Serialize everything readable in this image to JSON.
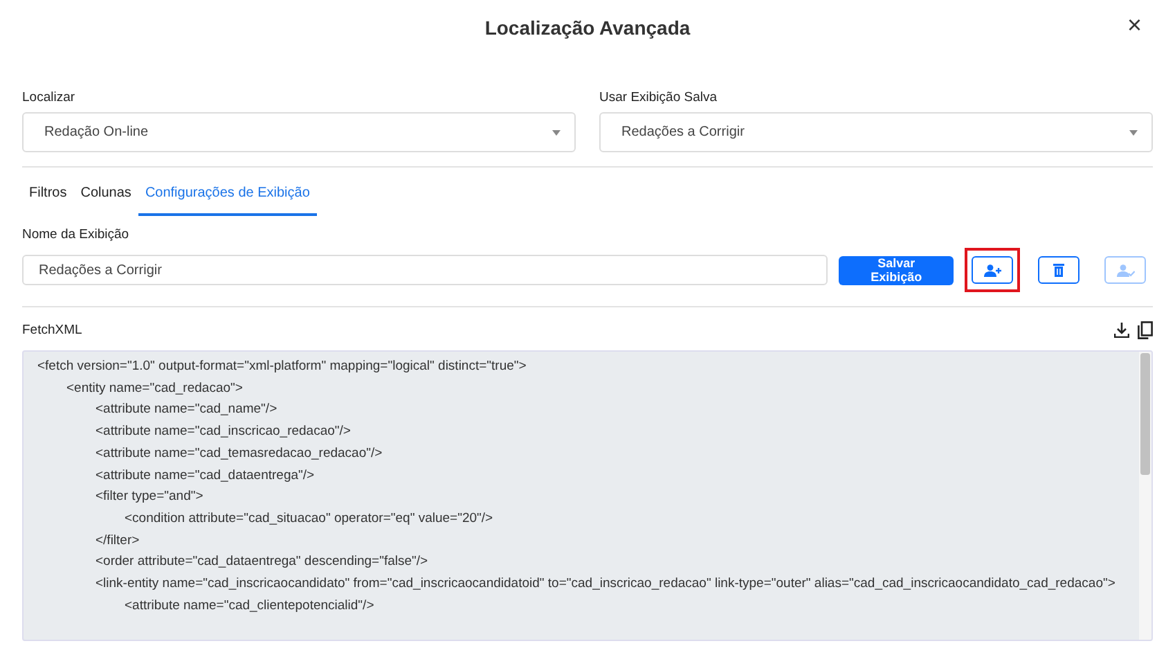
{
  "dialog": {
    "title": "Localização Avançada",
    "close": "×"
  },
  "find": {
    "label": "Localizar",
    "value": "Redação On-line"
  },
  "saved_view": {
    "label": "Usar Exibição Salva",
    "value": "Redações a Corrigir"
  },
  "tabs": [
    {
      "label": "Filtros",
      "selected": false
    },
    {
      "label": "Colunas",
      "selected": false
    },
    {
      "label": "Configurações de Exibição",
      "selected": true
    }
  ],
  "view_name": {
    "label": "Nome da Exibição",
    "value": "Redações a Corrigir"
  },
  "save_button": "Salvar Exibição",
  "icon_buttons": [
    {
      "kind": "add-user",
      "highlighted": true,
      "disabled": false
    },
    {
      "kind": "delete",
      "highlighted": false,
      "disabled": false
    },
    {
      "kind": "user-check",
      "highlighted": false,
      "disabled": true
    }
  ],
  "fetchxml": {
    "label": "FetchXML",
    "lines": [
      {
        "text": "<fetch version=\"1.0\" output-format=\"xml-platform\" mapping=\"logical\" distinct=\"true\">",
        "children": [
          {
            "text": "<entity name=\"cad_redacao\">",
            "children": [
              {
                "text": "<attribute name=\"cad_name\"/>"
              },
              {
                "text": "<attribute name=\"cad_inscricao_redacao\"/>"
              },
              {
                "text": "<attribute name=\"cad_temasredacao_redacao\"/>"
              },
              {
                "text": "<attribute name=\"cad_dataentrega\"/>"
              },
              {
                "text": "<filter type=\"and\">",
                "children": [
                  {
                    "text": "<condition attribute=\"cad_situacao\" operator=\"eq\" value=\"20\"/>"
                  }
                ]
              },
              {
                "text": "</filter>"
              },
              {
                "text": "<order attribute=\"cad_dataentrega\" descending=\"false\"/>"
              },
              {
                "text": "<link-entity name=\"cad_inscricaocandidato\" from=\"cad_inscricaocandidatoid\" to=\"cad_inscricao_redacao\" link-type=\"outer\" alias=\"cad_cad_inscricaocandidato_cad_redacao\">",
                "children": [
                  {
                    "text": "<attribute name=\"cad_clientepotencialid\"/>"
                  }
                ]
              }
            ]
          }
        ]
      }
    ]
  }
}
